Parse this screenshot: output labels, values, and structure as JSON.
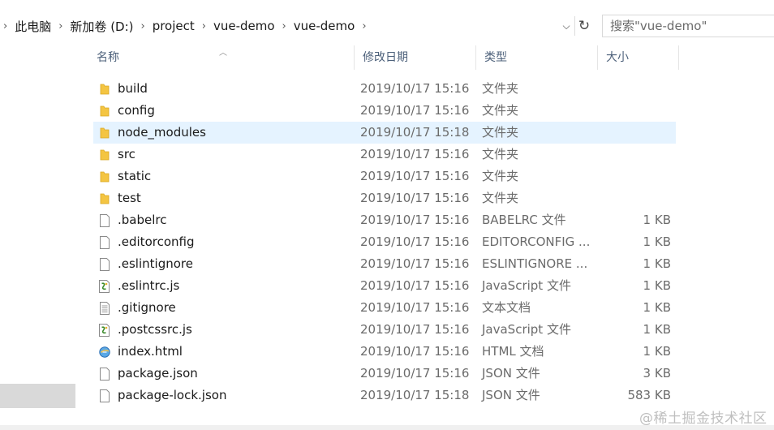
{
  "address": {
    "crumbs": [
      "此电脑",
      "新加卷 (D:)",
      "project",
      "vue-demo",
      "vue-demo"
    ],
    "dropdown_glyph": "⌵",
    "refresh_glyph": "↻"
  },
  "search": {
    "placeholder": "搜索\"vue-demo\""
  },
  "columns": {
    "name": "名称",
    "date": "修改日期",
    "type": "类型",
    "size": "大小"
  },
  "files": [
    {
      "name": "build",
      "date": "2019/10/17 15:16",
      "type": "文件夹",
      "size": "",
      "icon": "folder-icon"
    },
    {
      "name": "config",
      "date": "2019/10/17 15:16",
      "type": "文件夹",
      "size": "",
      "icon": "folder-icon"
    },
    {
      "name": "node_modules",
      "date": "2019/10/17 15:18",
      "type": "文件夹",
      "size": "",
      "icon": "folder-icon",
      "selected": true
    },
    {
      "name": "src",
      "date": "2019/10/17 15:16",
      "type": "文件夹",
      "size": "",
      "icon": "folder-icon"
    },
    {
      "name": "static",
      "date": "2019/10/17 15:16",
      "type": "文件夹",
      "size": "",
      "icon": "folder-icon"
    },
    {
      "name": "test",
      "date": "2019/10/17 15:16",
      "type": "文件夹",
      "size": "",
      "icon": "folder-icon"
    },
    {
      "name": ".babelrc",
      "date": "2019/10/17 15:16",
      "type": "BABELRC 文件",
      "size": "1 KB",
      "icon": "file-icon"
    },
    {
      "name": ".editorconfig",
      "date": "2019/10/17 15:16",
      "type": "EDITORCONFIG ...",
      "size": "1 KB",
      "icon": "file-icon"
    },
    {
      "name": ".eslintignore",
      "date": "2019/10/17 15:16",
      "type": "ESLINTIGNORE ...",
      "size": "1 KB",
      "icon": "file-icon"
    },
    {
      "name": ".eslintrc.js",
      "date": "2019/10/17 15:16",
      "type": "JavaScript 文件",
      "size": "1 KB",
      "icon": "js-file-icon"
    },
    {
      "name": ".gitignore",
      "date": "2019/10/17 15:16",
      "type": "文本文档",
      "size": "1 KB",
      "icon": "text-file-icon"
    },
    {
      "name": ".postcssrc.js",
      "date": "2019/10/17 15:16",
      "type": "JavaScript 文件",
      "size": "1 KB",
      "icon": "js-file-icon"
    },
    {
      "name": "index.html",
      "date": "2019/10/17 15:16",
      "type": "HTML 文档",
      "size": "1 KB",
      "icon": "html-file-icon"
    },
    {
      "name": "package.json",
      "date": "2019/10/17 15:16",
      "type": "JSON 文件",
      "size": "3 KB",
      "icon": "file-icon"
    },
    {
      "name": "package-lock.json",
      "date": "2019/10/17 15:18",
      "type": "JSON 文件",
      "size": "583 KB",
      "icon": "file-icon"
    }
  ],
  "watermark": "@稀土掘金技术社区",
  "colors": {
    "selected_row": "#e5f3ff",
    "folder": "#f4c542",
    "header_text": "#4c607a"
  }
}
